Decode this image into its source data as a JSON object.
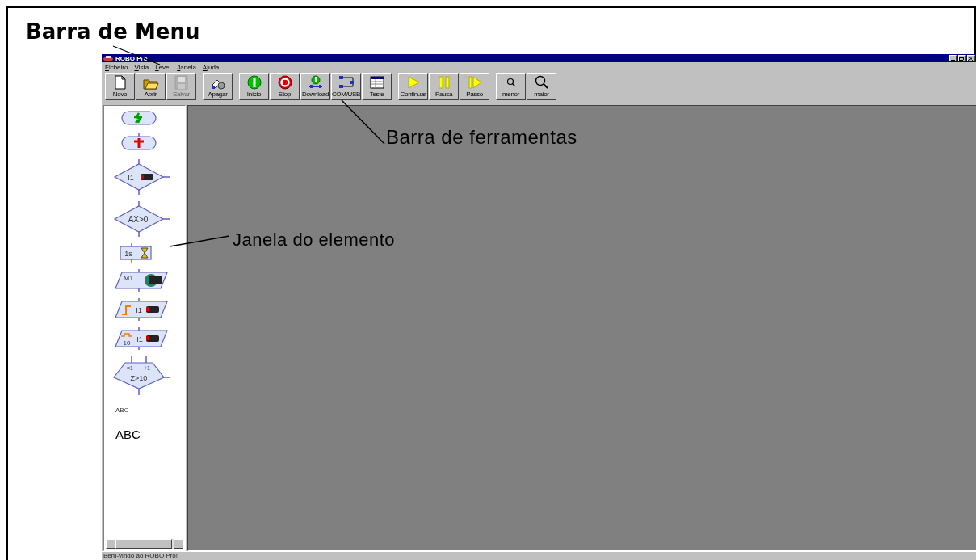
{
  "annotations": [
    {
      "kind": "menu-bar",
      "text": "Barra de Menu"
    },
    {
      "kind": "toolbar",
      "text": "Barra de ferramentas"
    },
    {
      "kind": "element-window",
      "text": "Janela do elemento"
    }
  ],
  "window": {
    "title": "ROBO Pro"
  },
  "menu": [
    "Ficheiro",
    "Vista",
    "Level",
    "Janela",
    "Ajuda"
  ],
  "toolbar": [
    [
      {
        "kind": "new",
        "label": "Novo",
        "disabled": false
      },
      {
        "kind": "open",
        "label": "Abrir",
        "disabled": false
      },
      {
        "kind": "save",
        "label": "Salvar",
        "disabled": true
      }
    ],
    [
      {
        "kind": "erase",
        "label": "Apagar",
        "disabled": false
      }
    ],
    [
      {
        "kind": "start",
        "label": "Início",
        "disabled": false
      },
      {
        "kind": "stop",
        "label": "Stop",
        "disabled": false
      },
      {
        "kind": "download",
        "label": "Download",
        "disabled": false
      },
      {
        "kind": "port",
        "label": "COM/USB",
        "disabled": false
      },
      {
        "kind": "test",
        "label": "Teste",
        "disabled": false
      }
    ],
    [
      {
        "kind": "continue",
        "label": "Continuar",
        "disabled": false
      },
      {
        "kind": "pause",
        "label": "Pausa",
        "disabled": false
      },
      {
        "kind": "step",
        "label": "Passo",
        "disabled": false
      }
    ],
    [
      {
        "kind": "zoom-out",
        "label": "menor",
        "disabled": false
      },
      {
        "kind": "zoom-in",
        "label": "maior",
        "disabled": false
      }
    ]
  ],
  "palette": [
    {
      "kind": "start"
    },
    {
      "kind": "stop"
    },
    {
      "kind": "branch-input",
      "labels": [
        "I1"
      ]
    },
    {
      "kind": "branch-value",
      "labels": [
        "AX>0"
      ]
    },
    {
      "kind": "wait",
      "labels": [
        "1s"
      ]
    },
    {
      "kind": "motor",
      "labels": [
        "M1"
      ]
    },
    {
      "kind": "wait-edge",
      "labels": [
        "I1"
      ]
    },
    {
      "kind": "pulse-counter",
      "labels": [
        "10",
        "I1"
      ]
    },
    {
      "kind": "loop-counter",
      "labels": [
        "=1",
        "+1",
        "Z>10"
      ]
    },
    {
      "kind": "comment-small",
      "labels": [
        "ABC"
      ]
    },
    {
      "kind": "comment-large",
      "labels": [
        "ABC"
      ]
    }
  ],
  "status_bar": "Bem-vindo ao ROBO Pro!"
}
